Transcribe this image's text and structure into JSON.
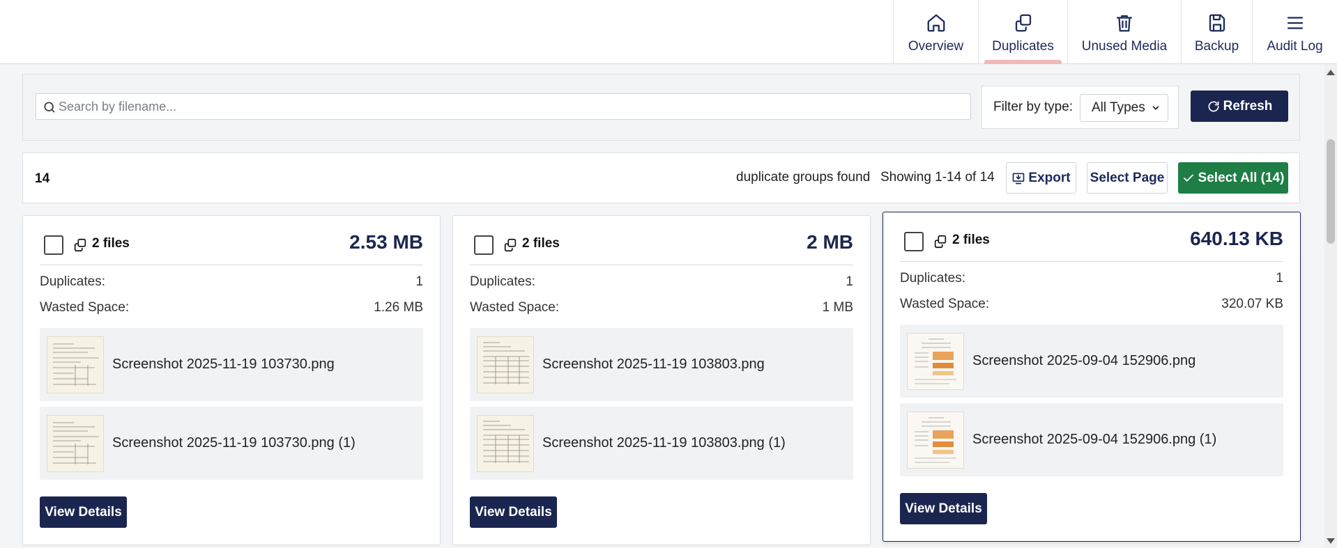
{
  "nav": {
    "items": [
      {
        "label": "Overview",
        "icon": "home-icon",
        "active": false
      },
      {
        "label": "Duplicates",
        "icon": "duplicate-icon",
        "active": true
      },
      {
        "label": "Unused Media",
        "icon": "trash-icon",
        "active": false
      },
      {
        "label": "Backup",
        "icon": "save-icon",
        "active": false
      },
      {
        "label": "Audit Log",
        "icon": "menu-icon",
        "active": false
      }
    ]
  },
  "toolbar": {
    "search_placeholder": "Search by filename...",
    "search_value": "",
    "filter_label": "Filter by type:",
    "filter_selected": "All Types",
    "refresh_label": "Refresh"
  },
  "summary": {
    "count": "14",
    "found_text": "duplicate groups found",
    "showing_text": "Showing 1-14 of 14",
    "export_label": "Export",
    "select_page_label": "Select Page",
    "select_all_label": "Select All (14)"
  },
  "cards": [
    {
      "files_label": "2 files",
      "size": "2.53 MB",
      "duplicates_label": "Duplicates:",
      "duplicates_value": "1",
      "wasted_label": "Wasted Space:",
      "wasted_value": "1.26 MB",
      "files": [
        "Screenshot 2025-11-19 103730.png",
        "Screenshot 2025-11-19 103730.png (1)"
      ],
      "view_label": "View Details"
    },
    {
      "files_label": "2 files",
      "size": "2 MB",
      "duplicates_label": "Duplicates:",
      "duplicates_value": "1",
      "wasted_label": "Wasted Space:",
      "wasted_value": "1 MB",
      "files": [
        "Screenshot 2025-11-19 103803.png",
        "Screenshot 2025-11-19 103803.png (1)"
      ],
      "view_label": "View Details"
    },
    {
      "files_label": "2 files",
      "size": "640.13 KB",
      "duplicates_label": "Duplicates:",
      "duplicates_value": "1",
      "wasted_label": "Wasted Space:",
      "wasted_value": "320.07 KB",
      "files": [
        "Screenshot 2025-09-04 152906.png",
        "Screenshot 2025-09-04 152906.png (1)"
      ],
      "view_label": "View Details"
    }
  ],
  "colors": {
    "primary": "#1b2650",
    "success": "#1e7e46",
    "active_tab_indicator": "#f2b8b8"
  }
}
